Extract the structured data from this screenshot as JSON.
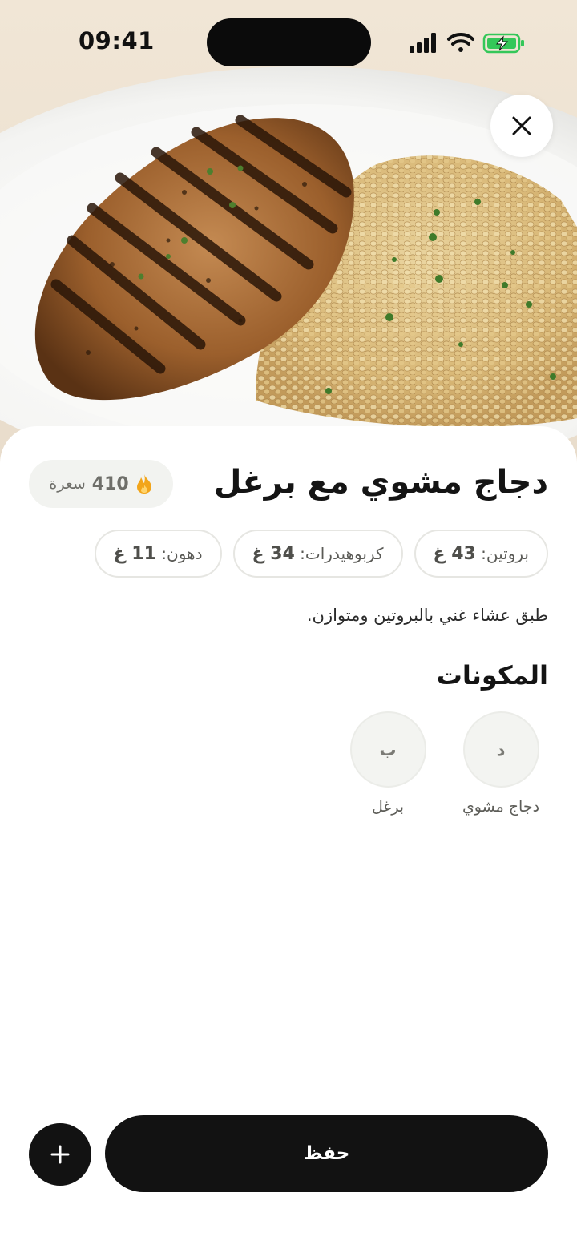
{
  "status_bar": {
    "time": "09:41",
    "icons": [
      "signal-icon",
      "wifi-icon",
      "battery-charging-icon"
    ]
  },
  "hero": {
    "subject": "grilled-chicken-bulgur-photo"
  },
  "close_button": {
    "icon": "close-icon"
  },
  "meal": {
    "title": "دجاج مشوي مع برغل",
    "calories_value": "410",
    "calories_unit": "سعرة",
    "calories_icon": "flame-icon",
    "macros": [
      {
        "label": "بروتين:",
        "value": "43 غ"
      },
      {
        "label": "كربوهيدرات:",
        "value": "34 غ"
      },
      {
        "label": "دهون:",
        "value": "11 غ"
      }
    ],
    "description": "طبق عشاء غني بالبروتين ومتوازن."
  },
  "ingredients": {
    "title": "المكونات",
    "items": [
      {
        "initial": "د",
        "name": "دجاج مشوي"
      },
      {
        "initial": "ب",
        "name": "برغل"
      }
    ]
  },
  "actions": {
    "save_label": "حفظ",
    "add_icon": "plus-icon"
  },
  "colors": {
    "primary_dark": "#121212",
    "flame": "#f2a51a",
    "battery": "#34c759",
    "pill_bg": "#f2f3f0"
  }
}
